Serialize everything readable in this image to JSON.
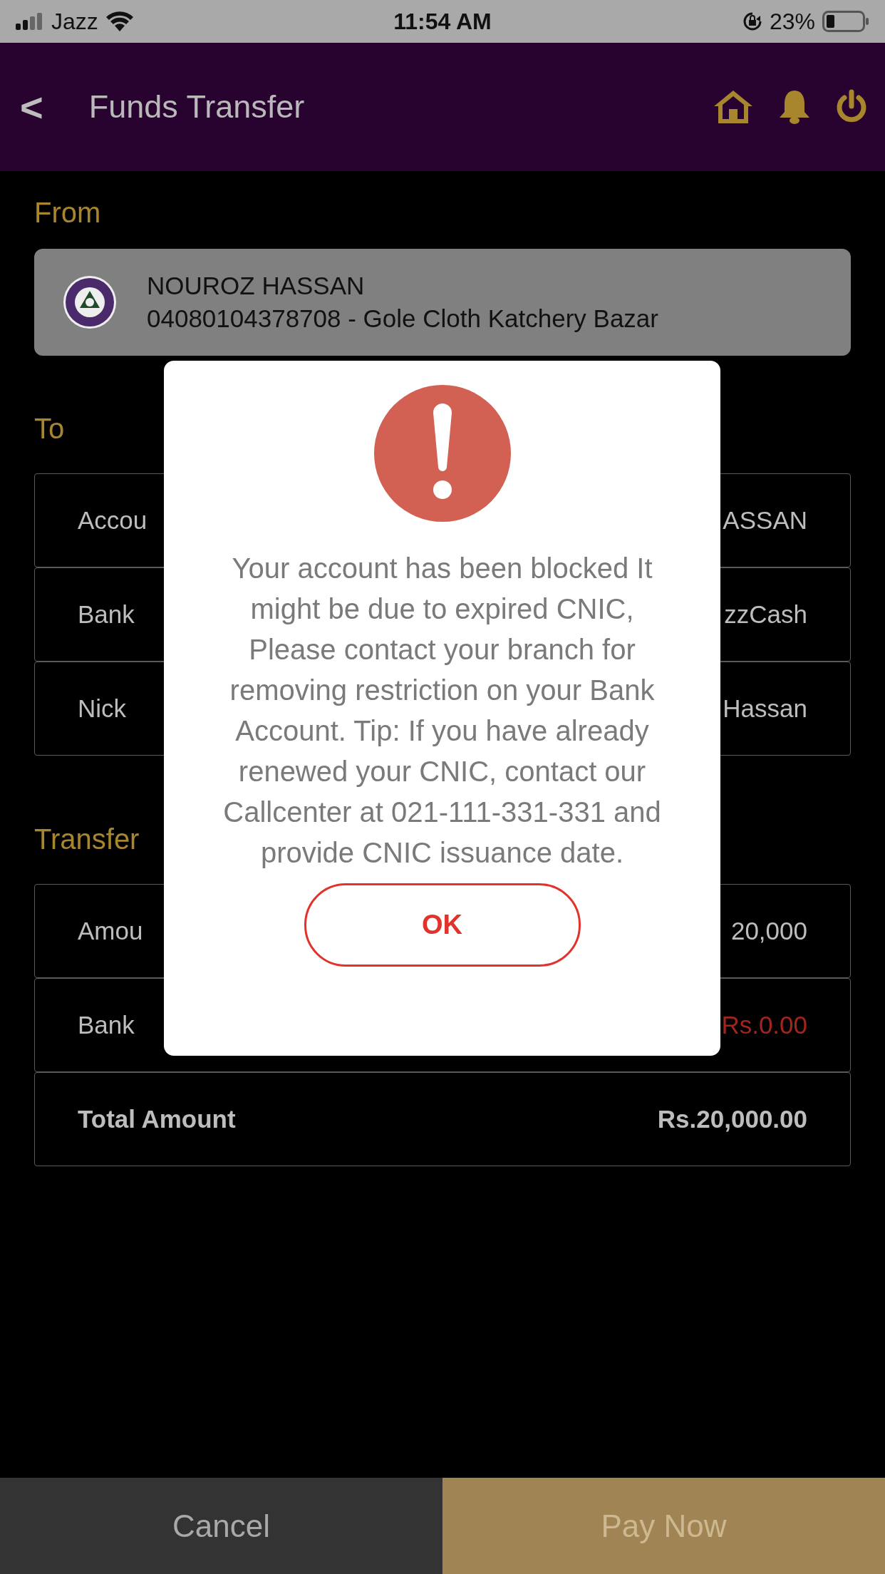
{
  "status_bar": {
    "carrier": "Jazz",
    "time": "11:54 AM",
    "battery": "23%"
  },
  "header": {
    "back": "<",
    "title": "Funds Transfer"
  },
  "from": {
    "label": "From",
    "account": {
      "name": "NOUROZ HASSAN",
      "detail": "04080104378708 - Gole Cloth Katchery Bazar"
    }
  },
  "to": {
    "label": "To",
    "rows": [
      {
        "label": "Accou",
        "value": "ASSAN"
      },
      {
        "label": "Bank",
        "value": "zzCash"
      },
      {
        "label": "Nick",
        "value": "Hassan"
      }
    ]
  },
  "transfer": {
    "label": "Transfer",
    "rows": [
      {
        "label": "Amou",
        "value": "20,000",
        "kind": "plain"
      },
      {
        "label": "Bank",
        "value": "Rs.0.00",
        "kind": "charge"
      },
      {
        "label": "Total Amount",
        "value": "Rs.20,000.00",
        "kind": "total"
      }
    ]
  },
  "dialog": {
    "message": "Your account has been blocked It might be due to expired CNIC, Please contact your branch for removing restriction on your Bank Account. Tip:  If you have already renewed your CNIC, contact our Callcenter at 021-111-331-331 and provide CNIC issuance date.",
    "button": "OK"
  },
  "footer": {
    "cancel": "Cancel",
    "pay": "Pay Now"
  }
}
